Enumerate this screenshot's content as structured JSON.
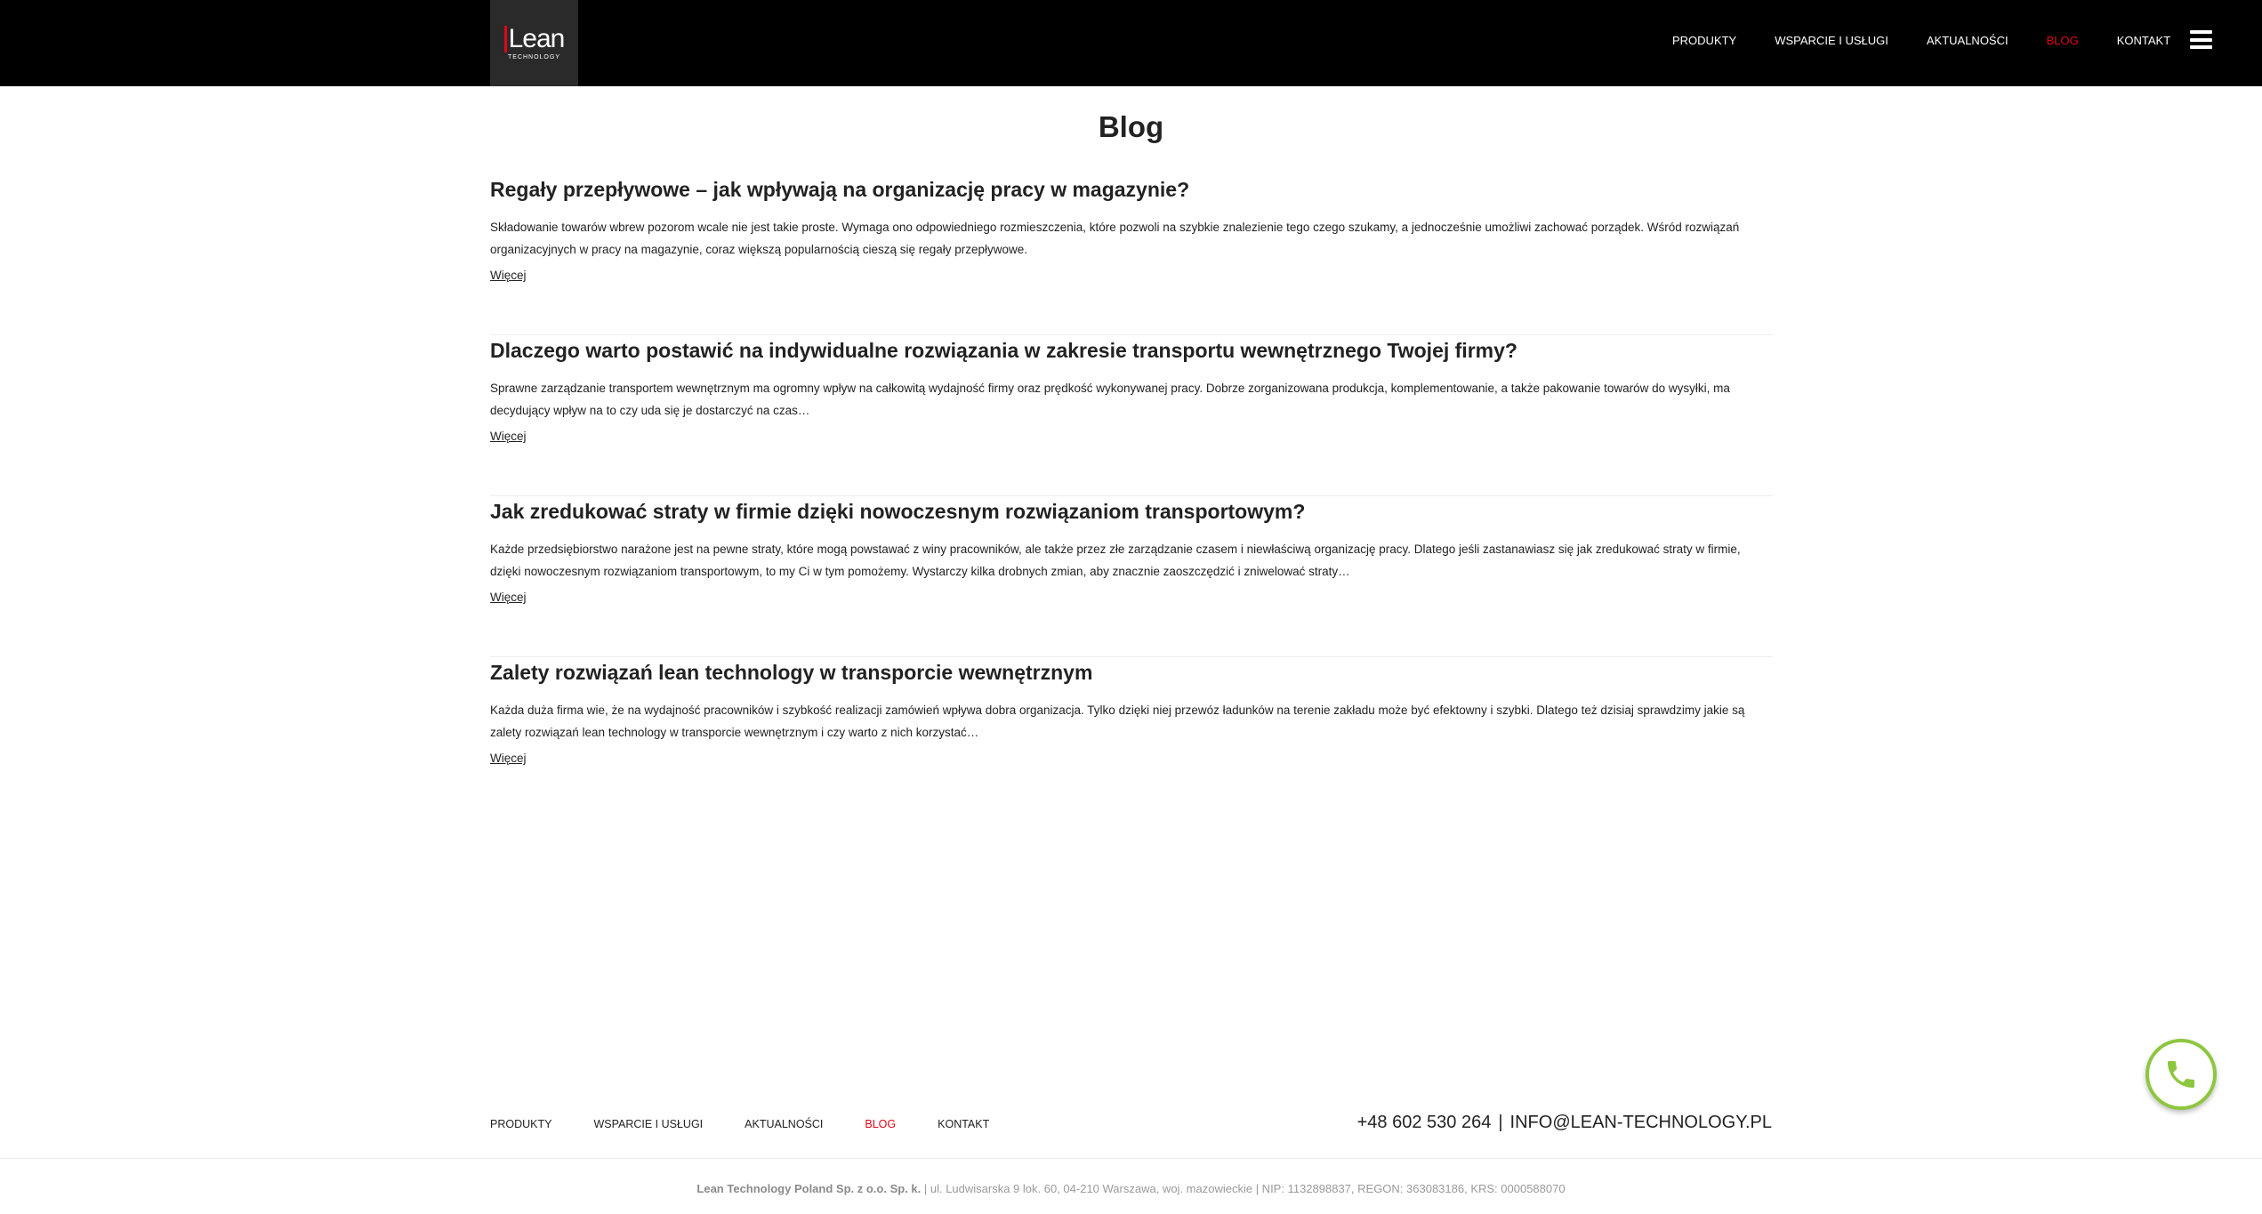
{
  "header": {
    "logo_text": "Lean",
    "logo_sub": "TECHNOLOGY",
    "nav": [
      {
        "label": "PRODUKTY",
        "active": false
      },
      {
        "label": "WSPARCIE I USŁUGI",
        "active": false
      },
      {
        "label": "AKTUALNOŚCI",
        "active": false
      },
      {
        "label": "BLOG",
        "active": true
      },
      {
        "label": "KONTAKT",
        "active": false
      }
    ],
    "menu_icon": "hamburger-icon"
  },
  "main": {
    "title": "Blog",
    "posts": [
      {
        "title": "Regały przepływowe – jak wpływają na organizację pracy w magazynie?",
        "excerpt": "Składowanie towarów wbrew pozorom wcale nie jest takie proste. Wymaga ono odpowiedniego rozmieszczenia, które pozwoli na szybkie znalezienie tego czego szukamy, a jednocześnie umożliwi zachować porządek. Wśród rozwiązań organizacyjnych w pracy na magazynie, coraz większą popularnością cieszą się regały przepływowe.",
        "more": "Więcej"
      },
      {
        "title": "Dlaczego warto postawić na indywidualne rozwiązania w zakresie transportu wewnętrznego Twojej firmy?",
        "excerpt": "Sprawne zarządzanie transportem wewnętrznym ma ogromny wpływ na całkowitą wydajność firmy oraz prędkość wykonywanej pracy. Dobrze zorganizowana produkcja, komplementowanie, a także pakowanie towarów do wysyłki, ma decydujący wpływ na to czy uda się je dostarczyć na czas…",
        "more": "Więcej"
      },
      {
        "title": "Jak zredukować straty w firmie dzięki nowoczesnym rozwiązaniom transportowym?",
        "excerpt": "Każde przedsiębiorstwo narażone jest na pewne straty, które mogą powstawać z winy pracowników, ale także przez złe zarządzanie czasem i niewłaściwą organizację pracy. Dlatego jeśli zastanawiasz się jak zredukować straty w firmie, dzięki nowoczesnym rozwiązaniom transportowym, to my Ci w tym pomożemy. Wystarczy kilka drobnych zmian, aby znacznie zaoszczędzić i zniwelować straty…",
        "more": "Więcej"
      },
      {
        "title": "Zalety rozwiązań lean technology w transporcie wewnętrznym",
        "excerpt": "Każda duża firma wie, że na wydajność pracowników i szybkość realizacji zamówień wpływa dobra organizacja. Tylko dzięki niej przewóz ładunków na terenie zakładu może być efektowny i szybki. Dlatego też dzisiaj sprawdzimy jakie są zalety rozwiązań lean technology w transporcie wewnętrznym i czy warto z nich korzystać…",
        "more": "Więcej"
      }
    ]
  },
  "footer": {
    "nav": [
      {
        "label": "PRODUKTY",
        "active": false
      },
      {
        "label": "WSPARCIE I USŁUGI",
        "active": false
      },
      {
        "label": "AKTUALNOŚCI",
        "active": false
      },
      {
        "label": "BLOG",
        "active": true
      },
      {
        "label": "KONTAKT",
        "active": false
      }
    ],
    "phone_prefix": "+48",
    "phone_number": "602 530 264",
    "separator": "|",
    "email": "INFO@LEAN-TECHNOLOGY.PL",
    "company_name": "Lean Technology Poland Sp. z o.o. Sp. k.",
    "company_details": " | ul. Ludwisarska 9 lok. 60, 04-210 Warszawa, woj. mazowieckie | NIP: 1132898837, REGON: 363083186, KRS: 0000588070"
  },
  "floating": {
    "call_icon": "phone-icon"
  },
  "colors": {
    "accent": "#e30613",
    "header_bg": "#000000",
    "call_ring": "#8dc63f"
  }
}
